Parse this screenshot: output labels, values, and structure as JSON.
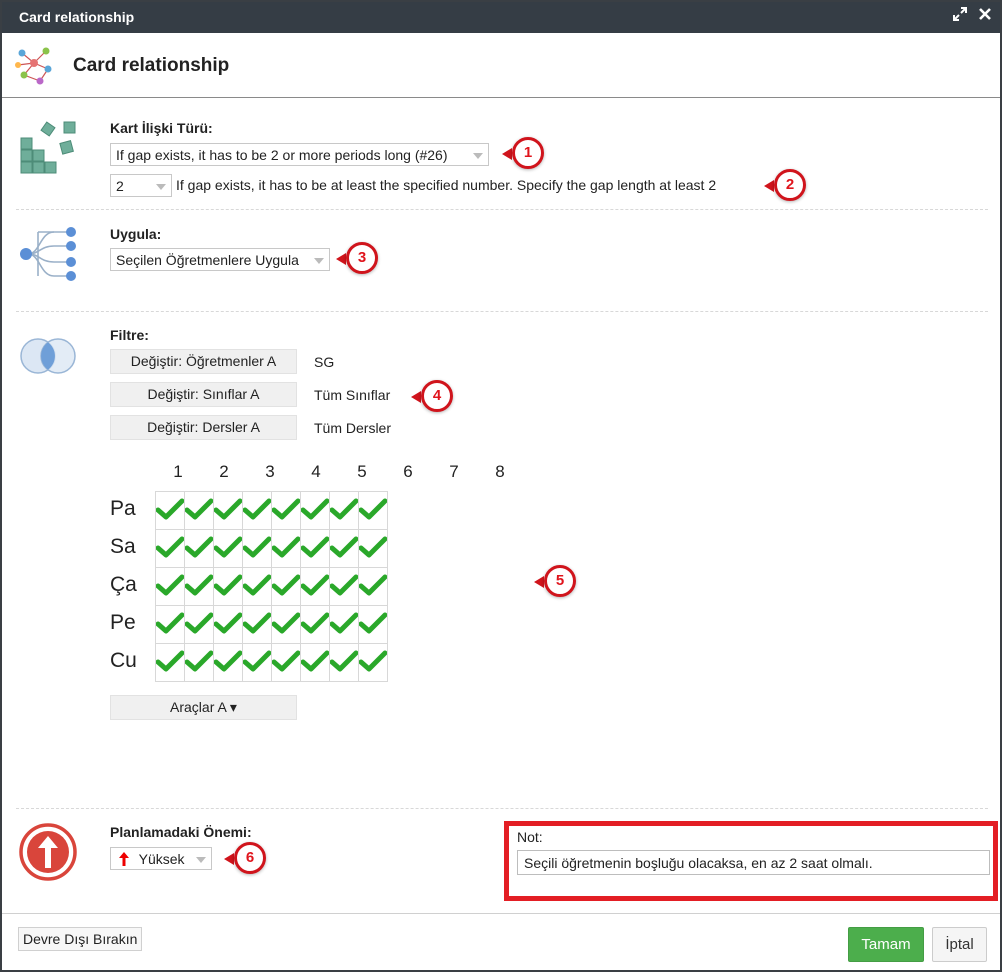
{
  "window": {
    "title": "Card relationship",
    "maximize_icon": "expand-icon",
    "close_icon": "close-icon"
  },
  "header": {
    "title": "Card relationship",
    "icon": "network-graph-icon"
  },
  "relation_type": {
    "label": "Kart İlişki Türü:",
    "icon": "cards-stack-icon",
    "selected": "If gap exists, it has to be 2 or more periods long (#26)",
    "number_value": "2",
    "description": "If gap exists, it has to be at least the specified number. Specify the gap length at least 2"
  },
  "apply": {
    "label": "Uygula:",
    "icon": "tree-branch-icon",
    "selected": "Seçilen Öğretmenlere Uygula"
  },
  "filter": {
    "label": "Filtre:",
    "icon": "venn-diagram-icon",
    "buttons": [
      {
        "label": "Değiştir: Öğretmenler A",
        "value": "SG"
      },
      {
        "label": "Değiştir: Sınıflar A",
        "value": "Tüm Sınıflar"
      },
      {
        "label": "Değiştir: Dersler A",
        "value": "Tüm Dersler"
      }
    ]
  },
  "grid": {
    "columns": [
      "1",
      "2",
      "3",
      "4",
      "5",
      "6",
      "7",
      "8"
    ],
    "rows": [
      "Pa",
      "Sa",
      "Ça",
      "Pe",
      "Cu"
    ],
    "cell_icon": "checkmark-icon",
    "all_checked": true
  },
  "tools": {
    "label": "Araçlar A ▾"
  },
  "importance": {
    "label": "Planlamadaki Önemi:",
    "icon": "arrow-up-circle-icon",
    "selected": "Yüksek"
  },
  "note": {
    "label": "Not:",
    "value": "Seçili öğretmenin boşluğu olacaksa, en az 2 saat olmalı."
  },
  "callouts": [
    "1",
    "2",
    "3",
    "4",
    "5",
    "6"
  ],
  "footer": {
    "disable_label": "Devre Dışı Bırakın",
    "ok_label": "Tamam",
    "cancel_label": "İptal"
  },
  "colors": {
    "titlebar": "#353d45",
    "ok_button": "#4cae4c",
    "callout_red": "#d0141c",
    "check_green": "#2aa82a",
    "icon_teal": "#6fae9a",
    "icon_blue": "#5b8fd6"
  }
}
